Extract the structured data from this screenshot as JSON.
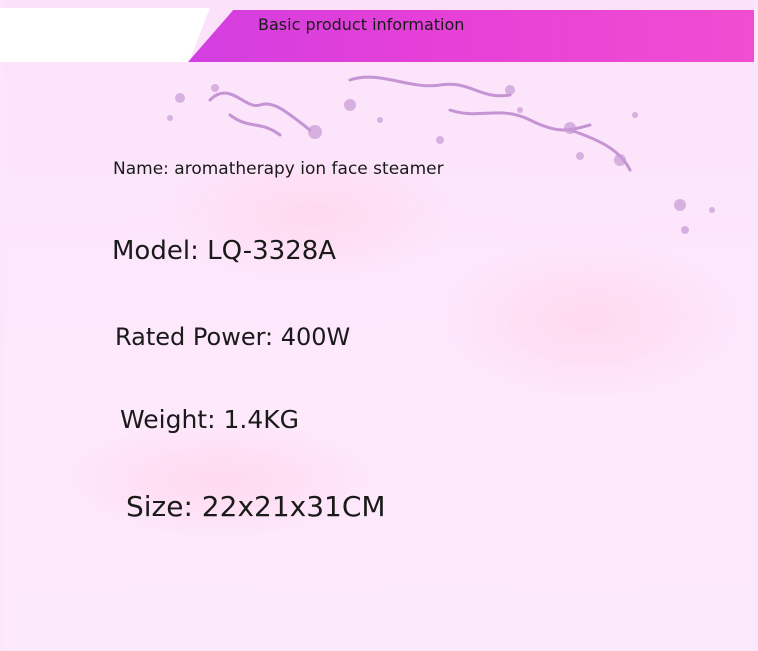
{
  "header": {
    "title": "Basic product information"
  },
  "product": {
    "name": "Name: aromatherapy ion face steamer",
    "model": "Model: LQ-3328A",
    "rated_power": "Rated Power: 400W",
    "weight": "Weight: 1.4KG",
    "size": "Size: 22x21x31CM"
  },
  "colors": {
    "header_bar": "#e43fd8",
    "background": "#fce6fb",
    "text": "#1a1a1a"
  }
}
